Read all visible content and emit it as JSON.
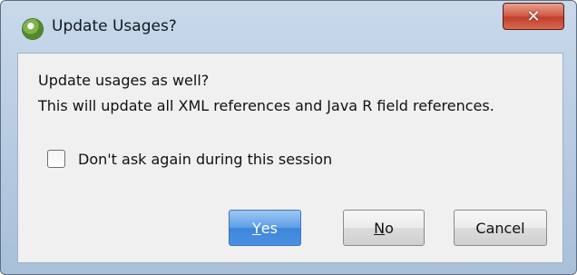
{
  "dialog": {
    "title": "Update Usages?",
    "close_symbol": "✕",
    "message_line1": "Update usages as well?",
    "message_line2": "This will update all XML references and Java R field references.",
    "checkbox_label": "Don't ask again during this session",
    "checkbox_checked": false,
    "buttons": {
      "yes": {
        "mnemonic": "Y",
        "rest": "es"
      },
      "no": {
        "mnemonic": "N",
        "rest": "o"
      },
      "cancel": {
        "label": "Cancel"
      }
    }
  },
  "icons": {
    "title_icon": "android-studio-icon",
    "close_icon": "close-icon",
    "checkbox": "checkbox-icon"
  },
  "colors": {
    "titlebar": "#b9cde3",
    "close_button": "#c0412b",
    "default_button": "#4a90e2",
    "client_background": "#f0f0f0"
  }
}
